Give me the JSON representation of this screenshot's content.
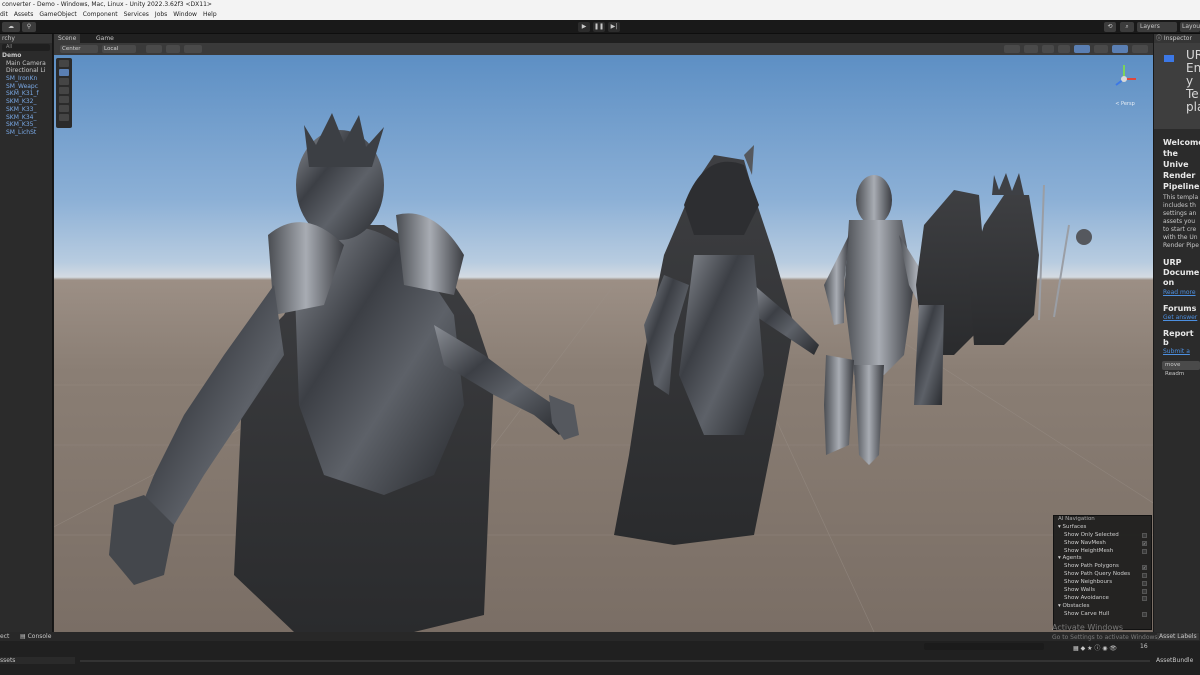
{
  "window": {
    "title": "converter - Demo - Windows, Mac, Linux - Unity 2022.3.62f3 <DX11>"
  },
  "menu": [
    "dit",
    "Assets",
    "GameObject",
    "Component",
    "Services",
    "Jobs",
    "Window",
    "Help"
  ],
  "toolbar": {
    "layers_label": "Layers",
    "layout_label": "Layou"
  },
  "hierarchy": {
    "tab": "rchy",
    "search_placeholder": "All",
    "scene": "Demo",
    "items": [
      "Main Camera",
      "Directional Li",
      "SM_IronKn",
      "SM_Weapc",
      "SKM_K31_f",
      "SKM_K32_",
      "SKM_K33_",
      "SKM_K34_",
      "SKM_K35_",
      "SM_LichSt"
    ]
  },
  "scene_tabs": {
    "scene": "Scene",
    "game": "Game"
  },
  "scene_toolbar": {
    "pivot": "Center",
    "space": "Local"
  },
  "gizmo": {
    "label": "< Persp"
  },
  "ai_navigation": {
    "title": "AI Navigation",
    "surfaces": "Surfaces",
    "surface_items": [
      {
        "label": "Show Only Selected",
        "checked": false
      },
      {
        "label": "Show NavMesh",
        "checked": true
      },
      {
        "label": "Show HeightMesh",
        "checked": false
      }
    ],
    "agents": "Agents",
    "agent_items": [
      {
        "label": "Show Path Polygons",
        "checked": true
      },
      {
        "label": "Show Path Query Nodes",
        "checked": false
      },
      {
        "label": "Show Neighbours",
        "checked": false
      },
      {
        "label": "Show Walls",
        "checked": false
      },
      {
        "label": "Show Avoidance",
        "checked": false
      }
    ],
    "obstacles": "Obstacles",
    "obstacle_items": [
      {
        "label": "Show Carve Hull",
        "checked": false
      }
    ]
  },
  "inspector": {
    "tab": "Inspector",
    "big_text": [
      "UR",
      "En",
      "y",
      "Te",
      "pla"
    ],
    "welcome": [
      "Welcome",
      "the Unive",
      "Render",
      "Pipeline"
    ],
    "desc": [
      "This templa",
      "includes th",
      "settings an",
      "assets you",
      "to start cre",
      "with the Un",
      "Render Pipe"
    ],
    "urp_doc": [
      "URP",
      "Documer",
      "on"
    ],
    "read_more": "Read more",
    "forums": "Forums",
    "get_answers": "Get answer",
    "report": "Report b",
    "submit": "Submit a ",
    "button": "move Readm"
  },
  "bottom": {
    "project_tab": "ect",
    "console_tab": "Console",
    "assets_label": "ssets",
    "asset_labels": "Asset Labels",
    "asset_bundle": "AssetBundle",
    "activate_title": "Activate Windows",
    "activate_sub": "Go to Settings to activate Windows.",
    "zoom_count": "16"
  },
  "colors": {
    "sky_top": "#5d8fc4",
    "ground": "#8a7e74",
    "editor_bg": "#191919",
    "panel_bg": "#2b2b2b",
    "accent_blue": "#7aa9e6"
  }
}
